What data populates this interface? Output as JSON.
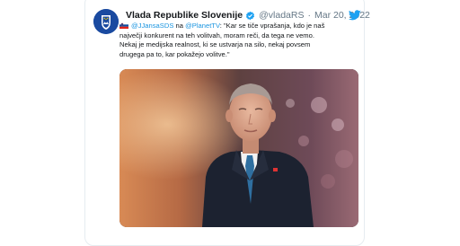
{
  "tweet": {
    "display_name": "Vlada Republike Slovenije",
    "handle": "@vladaRS",
    "separator": "·",
    "date": "Mar 20, 2022",
    "mention_1": "@JJansaSDS",
    "word_1": " na ",
    "mention_2": "@PlanetTV",
    "line_1_rest": ": \"Kar se tiče vprašanja, kdo je naš",
    "line_2": "največji konkurent na teh volitvah, moram reči, da tega ne vemo.",
    "line_3": "Nekaj je medijska realnost, ki se ustvarja na silo, nekaj povsem",
    "line_4": "drugega pa to, kar pokažejo volitve.\""
  },
  "colors": {
    "link": "#1b95e0",
    "twitter_blue": "#1da1f2",
    "name": "#14171a",
    "muted": "#657786"
  },
  "icons": {
    "avatar": "government-crest-icon",
    "verified": "verified-badge-icon",
    "brand": "twitter-bird-icon",
    "flag": "slovenia-flag-icon"
  }
}
